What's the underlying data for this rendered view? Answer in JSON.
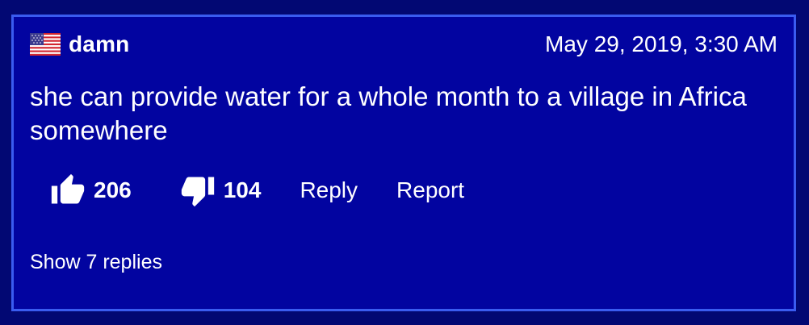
{
  "comment": {
    "flag_icon": "us-flag-icon",
    "username": "damn",
    "timestamp": "May 29, 2019, 3:30 AM",
    "text": "she can provide water for a whole month to a village in Africa somewhere",
    "likes": "206",
    "dislikes": "104",
    "reply_label": "Reply",
    "report_label": "Report",
    "show_replies_label": "Show 7 replies"
  },
  "colors": {
    "page_background": "#020873",
    "card_background": "#0204a0",
    "card_border": "#3a5cf0",
    "text": "#ffffff"
  },
  "icons": {
    "like": "thumbs-up-icon",
    "dislike": "thumbs-down-icon"
  }
}
